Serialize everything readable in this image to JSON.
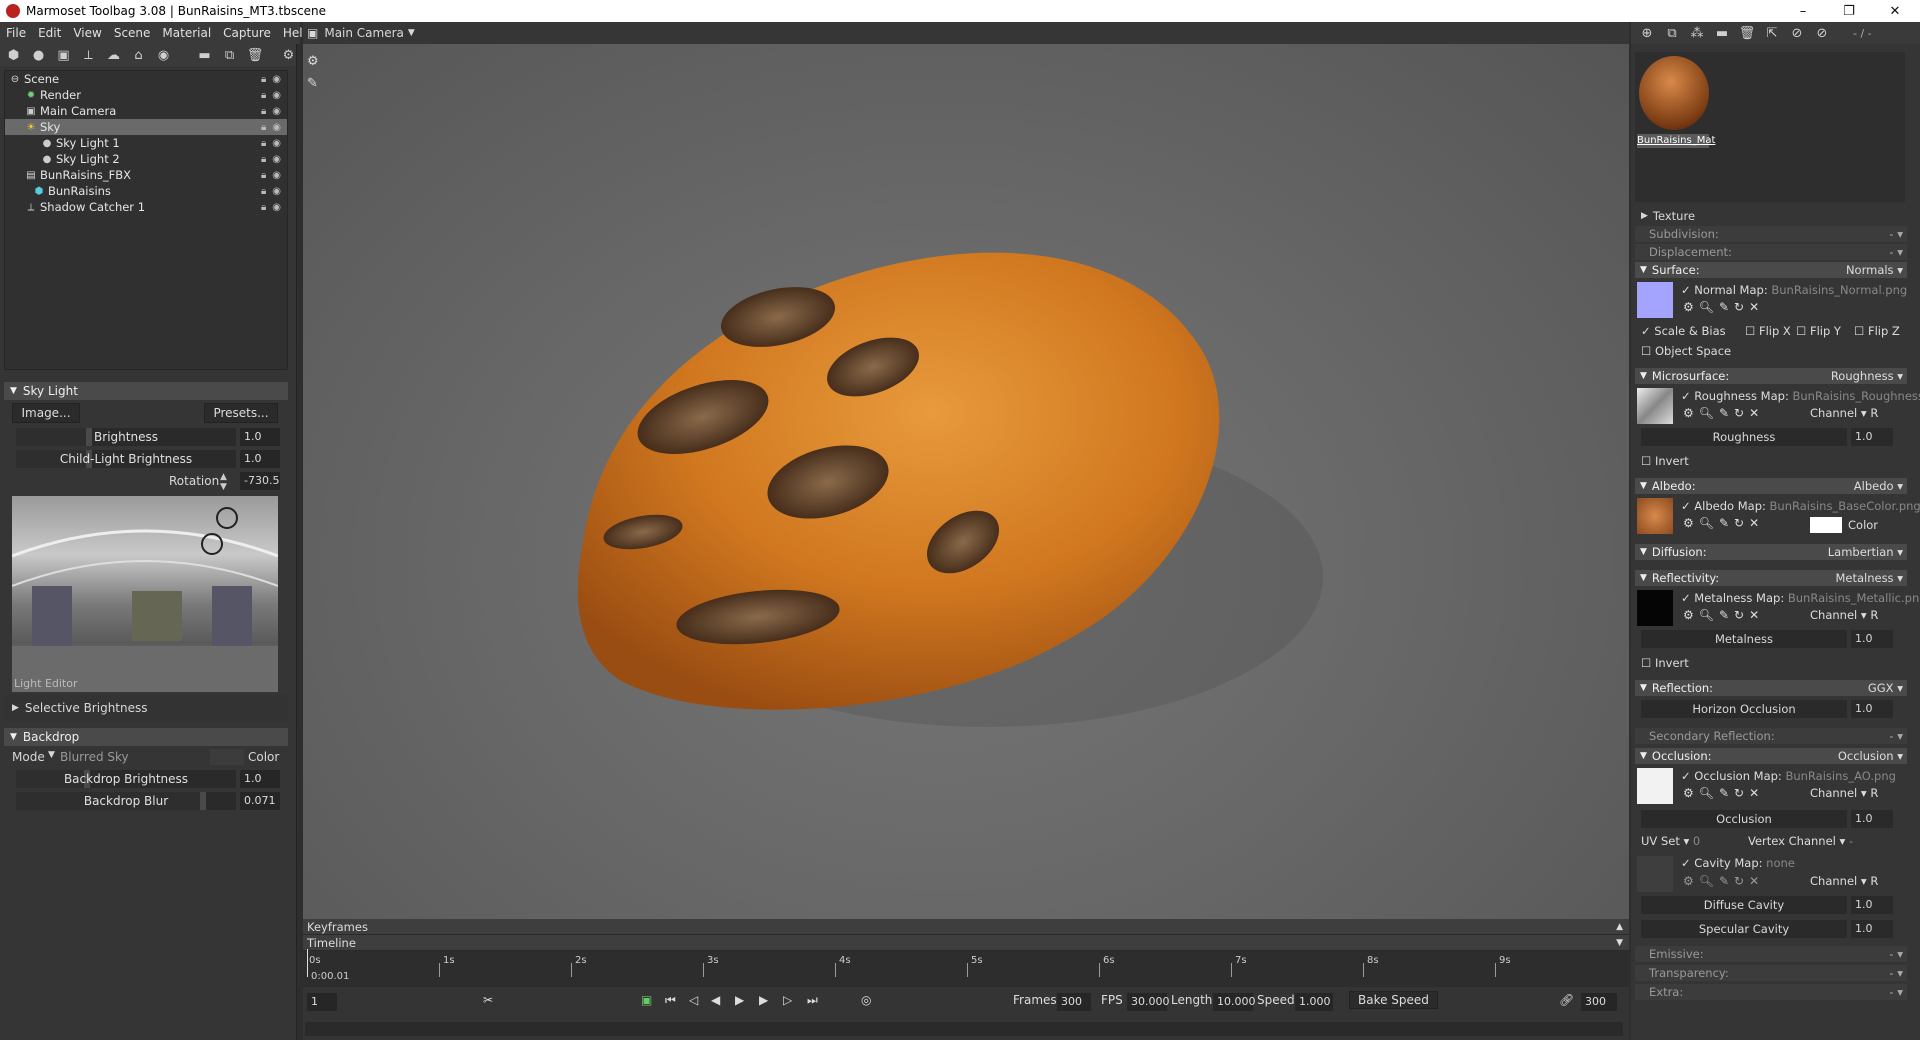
{
  "window": {
    "title": "Marmoset Toolbag 3.08  |  BunRaisins_MT3.tbscene",
    "minimize": "–",
    "maximize": "❐",
    "close": "✕"
  },
  "menu": [
    "File",
    "Edit",
    "View",
    "Scene",
    "Material",
    "Capture",
    "Help"
  ],
  "outliner": {
    "items": [
      {
        "label": "Scene",
        "icon": "scene-icon"
      },
      {
        "label": "Render",
        "icon": "render-icon"
      },
      {
        "label": "Main Camera",
        "icon": "camera-icon"
      },
      {
        "label": "Sky",
        "icon": "sky-icon"
      },
      {
        "label": "Sky Light 1",
        "icon": "light-icon"
      },
      {
        "label": "Sky Light 2",
        "icon": "light-icon"
      },
      {
        "label": "BunRaisins_FBX",
        "icon": "file-icon"
      },
      {
        "label": "BunRaisins",
        "icon": "mesh-icon"
      },
      {
        "label": "Shadow Catcher 1",
        "icon": "shadow-catcher-icon"
      }
    ]
  },
  "skylight": {
    "title": "Sky Light",
    "image_btn": "Image...",
    "presets_btn": "Presets...",
    "brightness_label": "Brightness",
    "brightness": "1.0",
    "child_label": "Child-Light Brightness",
    "child": "1.0",
    "rotation_label": "Rotation",
    "rotation": "-730.5",
    "light_editor": "Light Editor",
    "selective": "Selective Brightness"
  },
  "backdrop": {
    "title": "Backdrop",
    "mode_label": "Mode",
    "mode_value": "Blurred Sky",
    "color_label": "Color",
    "brightness_label": "Backdrop Brightness",
    "brightness": "1.0",
    "blur_label": "Backdrop Blur",
    "blur": "0.071"
  },
  "viewport": {
    "camera": "Main Camera"
  },
  "timeline": {
    "keyframes": "Keyframes",
    "timeline": "Timeline",
    "ticks": [
      "0s",
      "1s",
      "2s",
      "3s",
      "4s",
      "5s",
      "6s",
      "7s",
      "8s",
      "9s"
    ],
    "current_time": "0:00.01",
    "frame": "1",
    "frames_label": "Frames",
    "frames": "300",
    "fps_label": "FPS",
    "fps": "30.000",
    "length_label": "Length",
    "length": "10.000",
    "speed_label": "Speed",
    "speed": "1.000",
    "bake_speed": "Bake Speed",
    "end_frame": "300"
  },
  "material": {
    "name": "BunRaisins_Mat",
    "top_right": "- / -",
    "texture": "Texture",
    "subdivision": {
      "label": "Subdivision:",
      "value": "-"
    },
    "displacement": {
      "label": "Displacement:",
      "value": "-"
    },
    "surface": {
      "label": "Surface:",
      "value": "Normals"
    },
    "normal_map": {
      "label": "Normal Map:",
      "file": "BunRaisins_Normal.png"
    },
    "scale_bias": "Scale & Bias",
    "flip_x": "Flip X",
    "flip_y": "Flip Y",
    "flip_z": "Flip Z",
    "object_space": "Object Space",
    "microsurface": {
      "label": "Microsurface:",
      "value": "Roughness"
    },
    "roughness_map": {
      "label": "Roughness Map:",
      "file": "BunRaisins_Roughness.",
      "channel": "Channel",
      "channel_val": "R"
    },
    "roughness": {
      "label": "Roughness",
      "value": "1.0"
    },
    "invert": "Invert",
    "albedo": {
      "label": "Albedo:",
      "value": "Albedo"
    },
    "albedo_map": {
      "label": "Albedo Map:",
      "file": "BunRaisins_BaseColor.png",
      "color": "Color"
    },
    "diffusion": {
      "label": "Diffusion:",
      "value": "Lambertian"
    },
    "reflectivity": {
      "label": "Reflectivity:",
      "value": "Metalness"
    },
    "metal_map": {
      "label": "Metalness Map:",
      "file": "BunRaisins_Metallic.png",
      "channel": "Channel",
      "channel_val": "R"
    },
    "metalness": {
      "label": "Metalness",
      "value": "1.0"
    },
    "invert2": "Invert",
    "reflection": {
      "label": "Reflection:",
      "value": "GGX"
    },
    "horizon": {
      "label": "Horizon Occlusion",
      "value": "1.0"
    },
    "secondary": {
      "label": "Secondary Reflection:",
      "value": "-"
    },
    "occlusion": {
      "label": "Occlusion:",
      "value": "Occlusion"
    },
    "occ_map": {
      "label": "Occlusion Map:",
      "file": "BunRaisins_AO.png",
      "channel": "Channel",
      "channel_val": "R"
    },
    "occ": {
      "label": "Occlusion",
      "value": "1.0"
    },
    "uvset": {
      "label": "UV Set",
      "value": "0"
    },
    "vertex_channel": {
      "label": "Vertex Channel",
      "value": "-"
    },
    "cavity_map": {
      "label": "Cavity Map:",
      "file": "none",
      "channel": "Channel",
      "channel_val": "R"
    },
    "diffuse_cavity": {
      "label": "Diffuse Cavity",
      "value": "1.0"
    },
    "specular_cavity": {
      "label": "Specular Cavity",
      "value": "1.0"
    },
    "emissive": {
      "label": "Emissive:",
      "value": "-"
    },
    "transparency": {
      "label": "Transparency:",
      "value": "-"
    },
    "extra": {
      "label": "Extra:",
      "value": "-"
    }
  }
}
